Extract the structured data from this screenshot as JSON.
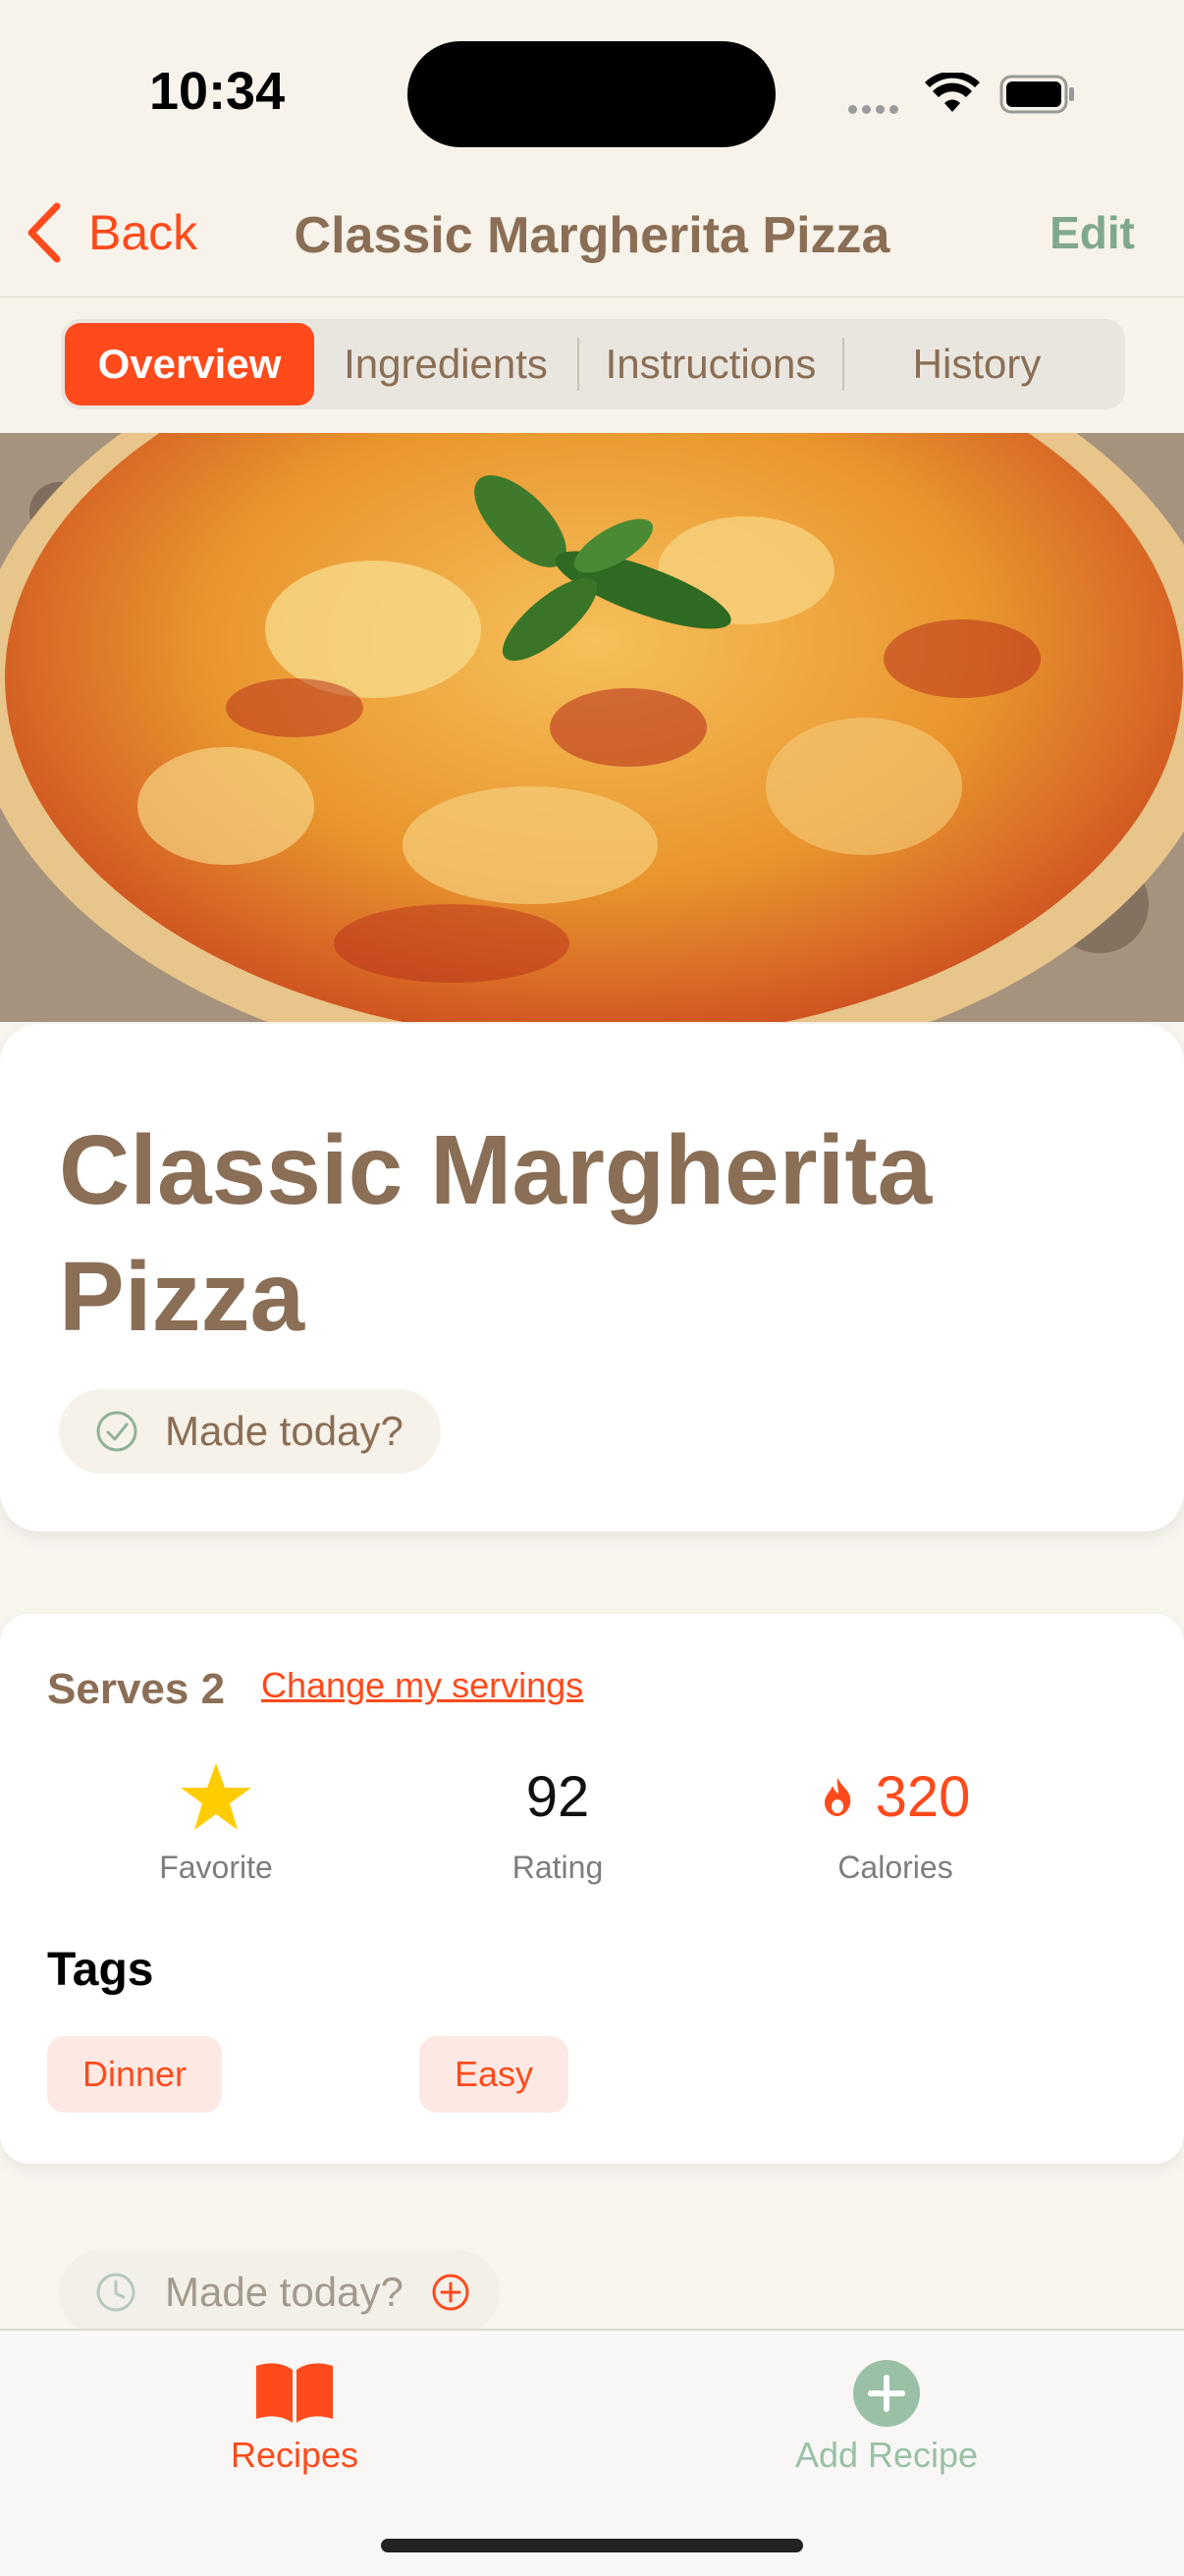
{
  "status_bar": {
    "time": "10:34"
  },
  "nav": {
    "back_label": "Back",
    "title": "Classic Margherita Pizza",
    "edit_label": "Edit"
  },
  "segments": {
    "tabs": [
      "Overview",
      "Ingredients",
      "Instructions",
      "History"
    ],
    "selected": "Overview"
  },
  "hero": {
    "alt": "pizza-photo"
  },
  "recipe": {
    "title": "Classic Margherita Pizza",
    "made_today_label": "Made today?"
  },
  "info": {
    "serves_label": "Serves 2",
    "change_servings_label": "Change my servings",
    "favorite_label": "Favorite",
    "rating_value": "92",
    "rating_label": "Rating",
    "calories_value": "320",
    "calories_label": "Calories",
    "tags_heading": "Tags",
    "tags": [
      "Dinner",
      "Easy"
    ]
  },
  "history_pill": {
    "label": "Made today?"
  },
  "tabbar": {
    "recipes_label": "Recipes",
    "add_label": "Add Recipe"
  },
  "colors": {
    "accent": "#ff4a1c",
    "brown": "#8a6e55",
    "green": "#7fa88f"
  },
  "icons": [
    "chevron-left-icon",
    "check-circle-icon",
    "star-icon",
    "flame-icon",
    "clock-icon",
    "plus-circle-icon",
    "book-icon",
    "add-circle-icon"
  ]
}
